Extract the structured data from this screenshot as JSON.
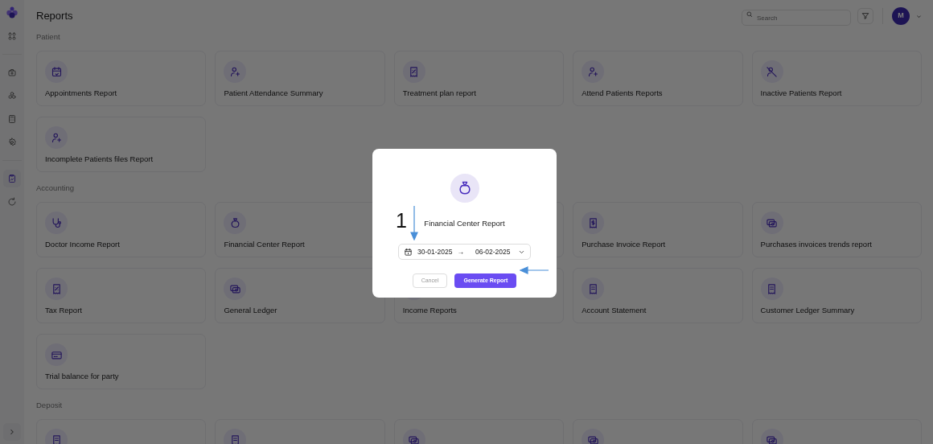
{
  "sidebar": {
    "items": [
      {
        "selected": false
      },
      {
        "selected": false
      },
      {
        "selected": false
      },
      {
        "selected": false
      },
      {
        "selected": false
      },
      {
        "selected": true
      },
      {
        "selected": false
      }
    ]
  },
  "page": {
    "title": "Reports"
  },
  "search": {
    "placeholder": "Search"
  },
  "user": {
    "initial": "M"
  },
  "sections": [
    {
      "title": "Patient",
      "cards": [
        {
          "title": "Appointments Report"
        },
        {
          "title": "Patient Attendance Summary"
        },
        {
          "title": "Treatment plan report"
        },
        {
          "title": "Attend Patients Reports"
        },
        {
          "title": "Inactive Patients Report"
        },
        {
          "title": "Incomplete Patients files Report"
        }
      ]
    },
    {
      "title": "Accounting",
      "cards": [
        {
          "title": "Doctor Income Report"
        },
        {
          "title": "Financial Center Report"
        },
        {
          "kind": "covered"
        },
        {
          "title": "Purchase Invoice Report"
        },
        {
          "title": "Purchases invoices trends report"
        },
        {
          "title": "Tax Report"
        },
        {
          "title": "General Ledger"
        },
        {
          "title": "Income Reports"
        },
        {
          "title": "Account Statement"
        },
        {
          "title": "Customer Ledger Summary"
        },
        {
          "title": "Trial balance for party"
        }
      ]
    },
    {
      "title": "Deposit",
      "cards": [
        {
          "kind": "cut"
        },
        {
          "kind": "cut"
        },
        {
          "kind": "cut"
        },
        {
          "kind": "cut"
        },
        {
          "kind": "cut"
        }
      ]
    }
  ],
  "modal": {
    "title": "Financial Center Report",
    "date_from": "30-01-2025",
    "separator": "→",
    "date_to": "06-02-2025",
    "buttons": [
      {
        "label": "Cancel",
        "kind": "secondary"
      },
      {
        "label": "Generate Report",
        "kind": "primary"
      }
    ],
    "annotation": {
      "label": "1"
    }
  }
}
